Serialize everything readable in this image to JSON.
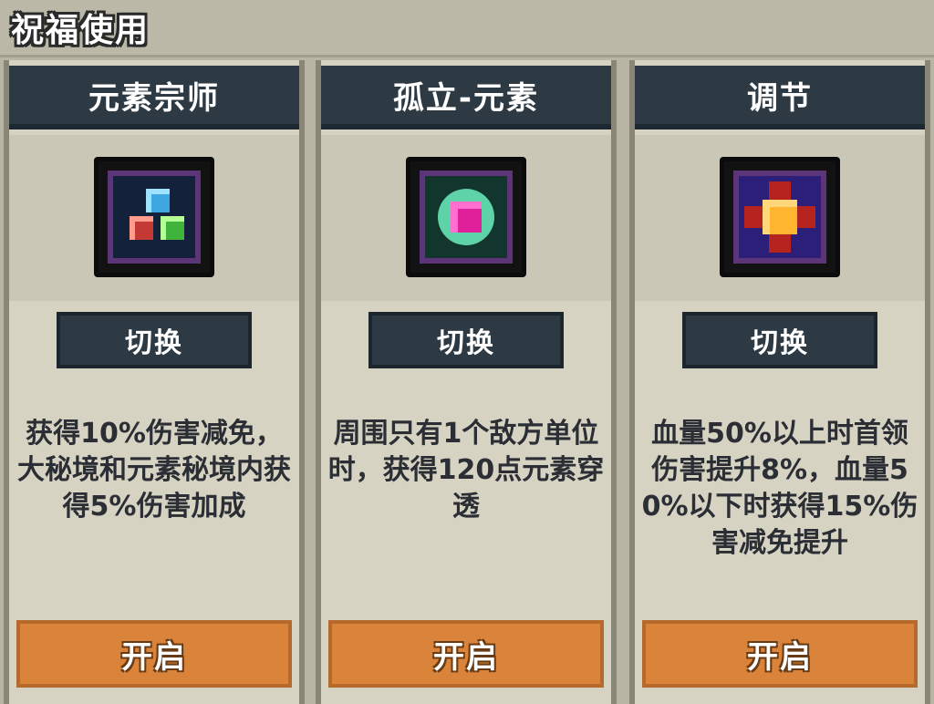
{
  "header": {
    "title": "祝福使用"
  },
  "cards": [
    {
      "title": "元素宗师",
      "icon": "elemental-gems-icon",
      "switch_label": "切换",
      "description": "获得10%伤害减免，大秘境和元素秘境内获得5%伤害加成",
      "open_label": "开启"
    },
    {
      "title": "孤立-元素",
      "icon": "isolated-element-icon",
      "switch_label": "切换",
      "description": "周围只有1个敌方单位时，获得120点元素穿透",
      "open_label": "开启"
    },
    {
      "title": "调节",
      "icon": "adjust-star-icon",
      "switch_label": "切换",
      "description": "血量50%以上时首领伤害提升8%，血量50%以下时获得15%伤害减免提升",
      "open_label": "开启"
    }
  ],
  "colors": {
    "card_title_bg": "#2d3a44",
    "open_button_bg": "#d9843a",
    "card_bg": "#d7d3c3"
  }
}
